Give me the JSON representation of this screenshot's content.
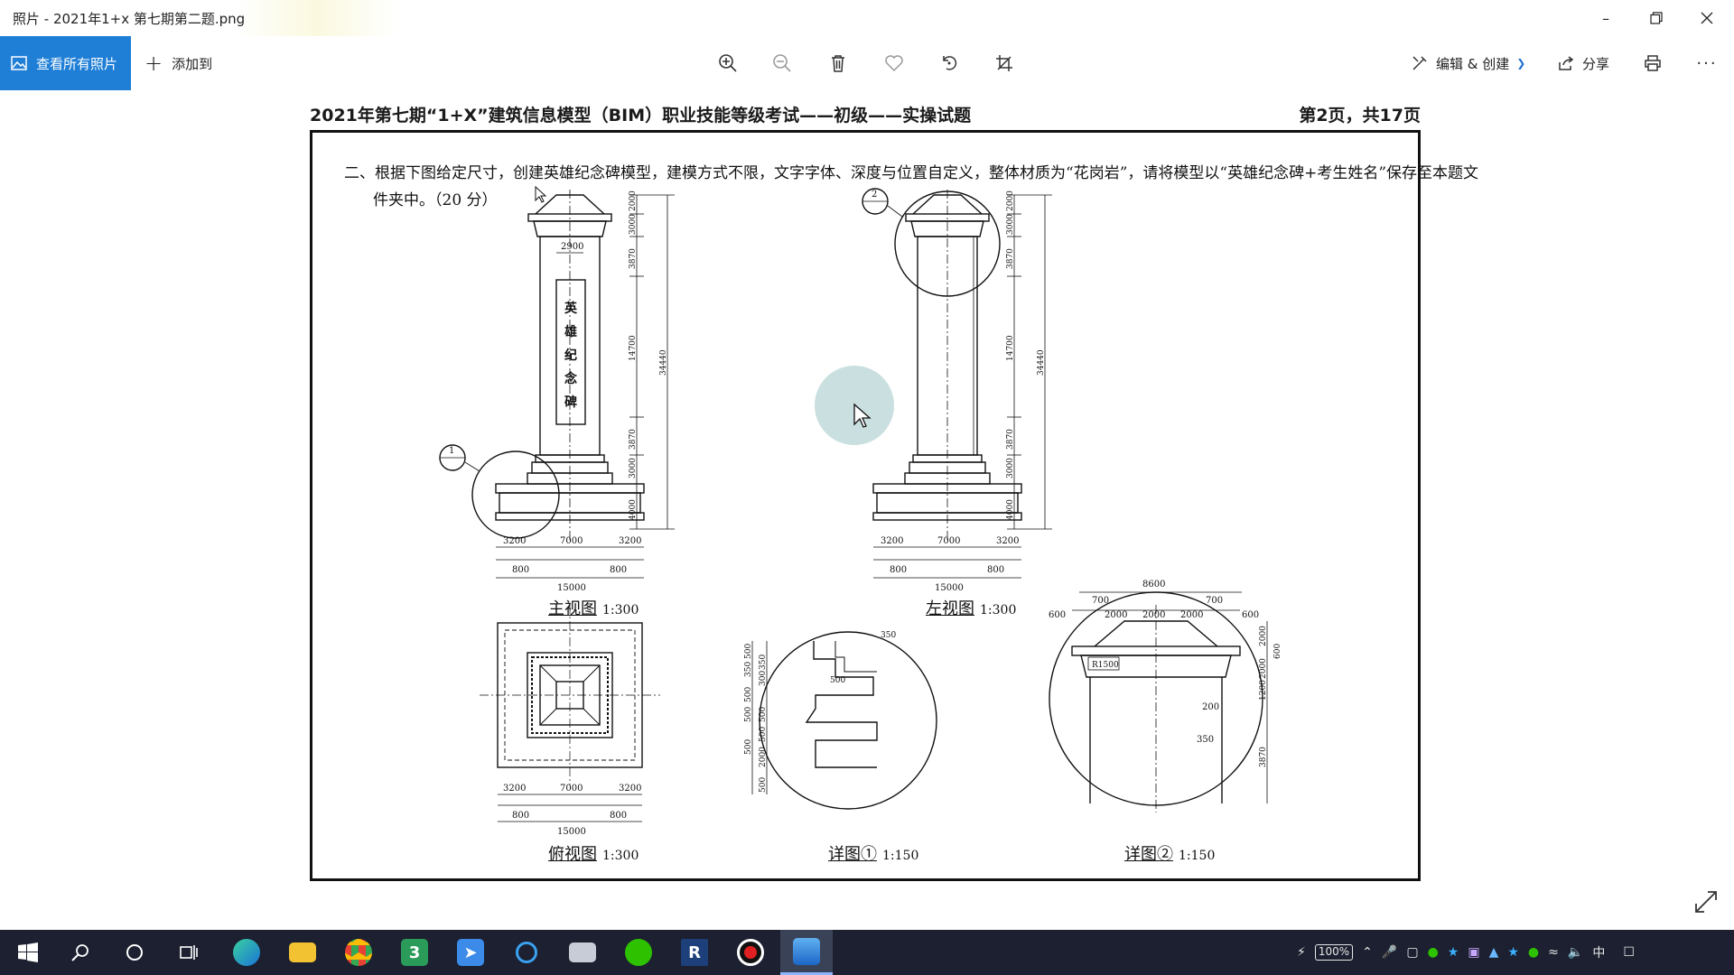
{
  "window": {
    "title": "照片 - 2021年1+x 第七期第二题.png",
    "minimize_icon": "minimize-icon",
    "restore_icon": "restore-icon",
    "close_icon": "close-icon"
  },
  "toolbar": {
    "all_photos_label": "查看所有照片",
    "add_to_label": "添加到",
    "edit_create_label": "编辑 & 创建",
    "share_label": "分享",
    "icons": [
      "zoom-in-icon",
      "zoom-out-icon",
      "delete-icon",
      "heart-icon",
      "rotate-icon",
      "crop-icon",
      "print-icon",
      "more-icon"
    ]
  },
  "document": {
    "header_left": "2021年第七期“1+X”建筑信息模型（BIM）职业技能等级考试——初级——实操试题",
    "header_right": "第2页，共17页",
    "question_line1": "二、根据下图给定尺寸，创建英雄纪念碑模型，建模方式不限，文字字体、深度与位置自定义，整体材质为“花岗岩”，请将模型以“英雄纪念碑+考生姓名”保存至本题文",
    "question_line2": "件夹中。（20 分）",
    "inscription": [
      "英",
      "雄",
      "纪",
      "念",
      "碑"
    ],
    "views": {
      "front": {
        "name": "主视图",
        "scale": "1:300"
      },
      "left": {
        "name": "左视图",
        "scale": "1:300"
      },
      "top": {
        "name": "俯视图",
        "scale": "1:300"
      },
      "detail1": {
        "name": "详图①",
        "scale": "1:150"
      },
      "detail2": {
        "name": "详图②",
        "scale": "1:150"
      }
    },
    "dims": {
      "top_width": "2900",
      "vertical": [
        "2000",
        "3000",
        "3870",
        "14700",
        "3870",
        "3000",
        "4000"
      ],
      "total_height": "34440",
      "bottom_row1": [
        "3200",
        "7000",
        "3200"
      ],
      "bottom_row2": [
        "800",
        "800"
      ],
      "bottom_total": "15000",
      "detail1_left": [
        "500",
        "350",
        "350",
        "300",
        "500",
        "500",
        "500",
        "500",
        "500",
        "2000",
        "500"
      ],
      "detail1_marks": [
        "350",
        "500"
      ],
      "detail2_top": [
        "8600",
        "700",
        "700",
        "600",
        "2000",
        "2000",
        "2000",
        "600"
      ],
      "detail2_right": [
        "2000",
        "600",
        "2000",
        "1200",
        "3870"
      ],
      "detail2_marks": [
        "200",
        "350",
        "R1500"
      ]
    },
    "callouts": [
      "1",
      "2"
    ]
  },
  "taskbar": {
    "apps": [
      "start-icon",
      "search-icon",
      "cortana-icon",
      "task-view-icon",
      "edge-icon",
      "file-explorer-icon",
      "chrome-icon",
      "app-3-icon",
      "feishu-icon",
      "search-app-icon",
      "scanner-icon",
      "wechat-icon",
      "revit-icon",
      "record-icon",
      "photos-icon"
    ],
    "revit_letter": "R",
    "app3_letter": "3",
    "battery": "100%",
    "ime": "中"
  }
}
